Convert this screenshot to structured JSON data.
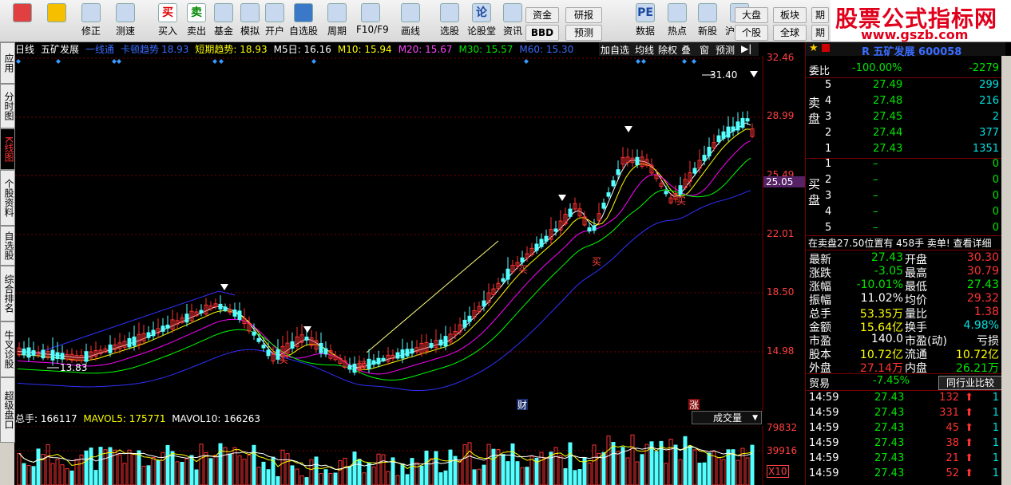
{
  "toolbar": {
    "buttons": [
      {
        "label": "",
        "icon": "windows-layout-icon"
      },
      {
        "label": "",
        "icon": "back-arrow-icon"
      },
      {
        "label": "修正",
        "icon": "up-down-arrow-icon"
      },
      {
        "label": "测速",
        "icon": "clock-icon"
      },
      {
        "label": "买入",
        "icon": "buy-icon",
        "glyph": "买"
      },
      {
        "label": "卖出",
        "icon": "sell-icon",
        "glyph": "卖"
      },
      {
        "label": "基金",
        "icon": "fund-icon"
      },
      {
        "label": "模拟",
        "icon": "hammer-icon"
      },
      {
        "label": "开户",
        "icon": "lock-icon"
      },
      {
        "label": "自选股",
        "icon": "star-icon"
      },
      {
        "label": "周期",
        "icon": "period-icon"
      },
      {
        "label": "F10/F9",
        "icon": "f10-icon"
      },
      {
        "label": "画线",
        "icon": "pencil-icon"
      },
      {
        "label": "选股",
        "icon": "stock-select-icon"
      },
      {
        "label": "论股堂",
        "icon": "forum-icon",
        "glyph": "论"
      },
      {
        "label": "资讯",
        "icon": "news-icon"
      },
      {
        "label": "数据",
        "icon": "pe-data-icon",
        "glyph": "PE"
      },
      {
        "label": "热点",
        "icon": "hotspot-icon"
      },
      {
        "label": "新股",
        "icon": "ipo-icon"
      },
      {
        "label": "沪港通",
        "icon": "hk-connect-icon"
      }
    ],
    "small": {
      "fund": "资金",
      "bbd": "BBD",
      "research": "研报",
      "forecast": "预测",
      "market": "大盘",
      "sector": "板块",
      "stock": "个股",
      "all": "全球",
      "more1": "期",
      "more2": "期"
    },
    "logo_text": "股票公式指标网",
    "logo_url": "www.gszb.com"
  },
  "left_tabs": [
    {
      "label": "应用",
      "active": false
    },
    {
      "label": "分时图",
      "active": false
    },
    {
      "label": "K线图",
      "active": true
    },
    {
      "label": "个股资料",
      "active": false
    },
    {
      "label": "自选股",
      "active": false
    },
    {
      "label": "综合排名",
      "active": false
    },
    {
      "label": "牛叉诊股",
      "active": false
    },
    {
      "label": "超级盘口",
      "active": false
    }
  ],
  "chart": {
    "period": "日线",
    "stock_name": "五矿发展",
    "indicator_1": "一线通",
    "indicator_2": "卡顿趋势",
    "indicator_2_value": "18.93",
    "indicator_3": "短期趋势: 18.93",
    "ma5": "M5日: 16.16",
    "ma10": "M10: 15.94",
    "ma20": "M20: 15.67",
    "ma30": "M30: 15.57",
    "ma60": "M60: 15.30",
    "tools": [
      "加自选",
      "均线",
      "除权",
      "叠",
      "窗",
      "预测"
    ],
    "price_ticks": [
      "32.46",
      "28.99",
      "25.49",
      "22.01",
      "18.50",
      "14.98"
    ],
    "current_price_tag": "25.05",
    "high_label": "31.40",
    "low_label": "13.83",
    "buy_marks": [
      "买",
      "买",
      "买",
      "买",
      "买",
      "买"
    ],
    "event_marks": [
      "财",
      "涨"
    ],
    "colors": {
      "up": "#ff3232",
      "down": "#54ffff",
      "ma5": "#ffffff",
      "ma10": "#ffff00",
      "ma20": "#ff00ff",
      "ma30": "#00ff00",
      "ma60": "#3030ff"
    }
  },
  "volume": {
    "total": "总手: 166117",
    "mavol5": "MAVOL5: 175771",
    "mavol10": "MAVOL10: 166263",
    "selector": "成交量",
    "ticks": [
      "79832",
      "39916",
      "X10"
    ]
  },
  "quote": {
    "header": "R 五矿发展 600058",
    "weibi_label": "委比",
    "weibi_value": "-100.00%",
    "weicha_value": "-2279",
    "sell_label": "卖盘",
    "buy_label": "买盘",
    "sells": [
      {
        "level": "5",
        "price": "27.49",
        "vol": "299"
      },
      {
        "level": "4",
        "price": "27.48",
        "vol": "216"
      },
      {
        "level": "3",
        "price": "27.45",
        "vol": "2"
      },
      {
        "level": "2",
        "price": "27.44",
        "vol": "377"
      },
      {
        "level": "1",
        "price": "27.43",
        "vol": "1351"
      }
    ],
    "buys": [
      {
        "level": "1",
        "price": "–",
        "vol": "0"
      },
      {
        "level": "2",
        "price": "–",
        "vol": "0"
      },
      {
        "level": "3",
        "price": "–",
        "vol": "0"
      },
      {
        "level": "4",
        "price": "–",
        "vol": "0"
      },
      {
        "level": "5",
        "price": "–",
        "vol": "0"
      }
    ],
    "notice": "在卖盘27.50位置有  458手  卖单! 查看详细",
    "stats": [
      {
        "l1": "最新",
        "v1": "27.43",
        "l2": "开盘",
        "v2": "30.30",
        "c1": "green",
        "c2": "red"
      },
      {
        "l1": "涨跌",
        "v1": "-3.05",
        "l2": "最高",
        "v2": "30.79",
        "c1": "green",
        "c2": "red"
      },
      {
        "l1": "涨幅",
        "v1": "-10.01%",
        "l2": "最低",
        "v2": "27.43",
        "c1": "green",
        "c2": "green"
      },
      {
        "l1": "振幅",
        "v1": "11.02%",
        "l2": "均价",
        "v2": "29.32",
        "c1": "white",
        "c2": "red"
      },
      {
        "l1": "总手",
        "v1": "53.35万",
        "l2": "量比",
        "v2": "1.38",
        "c1": "yellow",
        "c2": "red"
      },
      {
        "l1": "金额",
        "v1": "15.64亿",
        "l2": "换手",
        "v2": "4.98%",
        "c1": "yellow",
        "c2": "cyan"
      },
      {
        "l1": "市盈",
        "v1": "140.0",
        "l2": "市盈(动)",
        "v2": "亏损",
        "c1": "white",
        "c2": "white"
      },
      {
        "l1": "股本",
        "v1": "10.72亿",
        "l2": "流通",
        "v2": "10.72亿",
        "c1": "yellow",
        "c2": "yellow"
      },
      {
        "l1": "外盘",
        "v1": "27.14万",
        "l2": "内盘",
        "v2": "26.21万",
        "c1": "red",
        "c2": "green"
      }
    ],
    "industry": "贸易",
    "industry_change": "-7.45%",
    "industry_button": "同行业比较",
    "ticks": [
      {
        "time": "14:59",
        "price": "27.43",
        "vol": "132",
        "n": "1"
      },
      {
        "time": "14:59",
        "price": "27.43",
        "vol": "331",
        "n": "1"
      },
      {
        "time": "14:59",
        "price": "27.43",
        "vol": "45",
        "n": "1"
      },
      {
        "time": "14:59",
        "price": "27.43",
        "vol": "38",
        "n": "1"
      },
      {
        "time": "14:59",
        "price": "27.43",
        "vol": "21",
        "n": "1"
      },
      {
        "time": "14:59",
        "price": "27.43",
        "vol": "52",
        "n": "1"
      }
    ]
  }
}
